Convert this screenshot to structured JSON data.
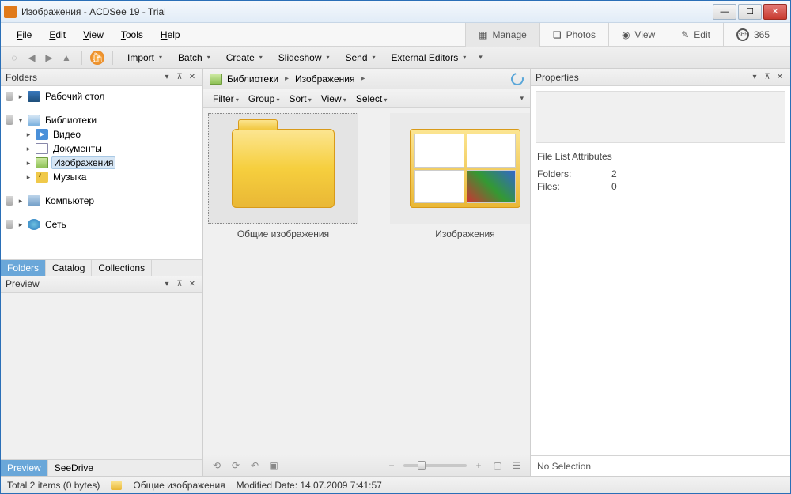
{
  "window": {
    "title": "Изображения - ACDSee 19 - Trial"
  },
  "menu": {
    "file": "File",
    "edit": "Edit",
    "view": "View",
    "tools": "Tools",
    "help": "Help"
  },
  "modes": {
    "manage": "Manage",
    "photos": "Photos",
    "view": "View",
    "edit": "Edit",
    "threesixtyfive": "365"
  },
  "toolbar": {
    "import": "Import",
    "batch": "Batch",
    "create": "Create",
    "slideshow": "Slideshow",
    "send": "Send",
    "external": "External Editors"
  },
  "folders_panel": {
    "title": "Folders",
    "desktop": "Рабочий стол",
    "libraries": "Библиотеки",
    "video": "Видео",
    "documents": "Документы",
    "images": "Изображения",
    "music": "Музыка",
    "computer": "Компьютер",
    "network": "Сеть",
    "tabs": {
      "folders": "Folders",
      "catalog": "Catalog",
      "collections": "Collections"
    }
  },
  "preview_panel": {
    "title": "Preview",
    "tabs": {
      "preview": "Preview",
      "seedrive": "SeeDrive"
    }
  },
  "breadcrumb": {
    "seg1": "Библиотеки",
    "seg2": "Изображения"
  },
  "filterbar": {
    "filter": "Filter",
    "group": "Group",
    "sort": "Sort",
    "view": "View",
    "select": "Select"
  },
  "thumbs": {
    "item1": "Общие изображения",
    "item2": "Изображения"
  },
  "properties": {
    "title": "Properties",
    "section": "File List Attributes",
    "folders_k": "Folders:",
    "folders_v": "2",
    "files_k": "Files:",
    "files_v": "0",
    "no_selection": "No Selection"
  },
  "status": {
    "total": "Total 2 items  (0 bytes)",
    "selected": "Общие изображения",
    "modified": "Modified Date: 14.07.2009 7:41:57"
  }
}
